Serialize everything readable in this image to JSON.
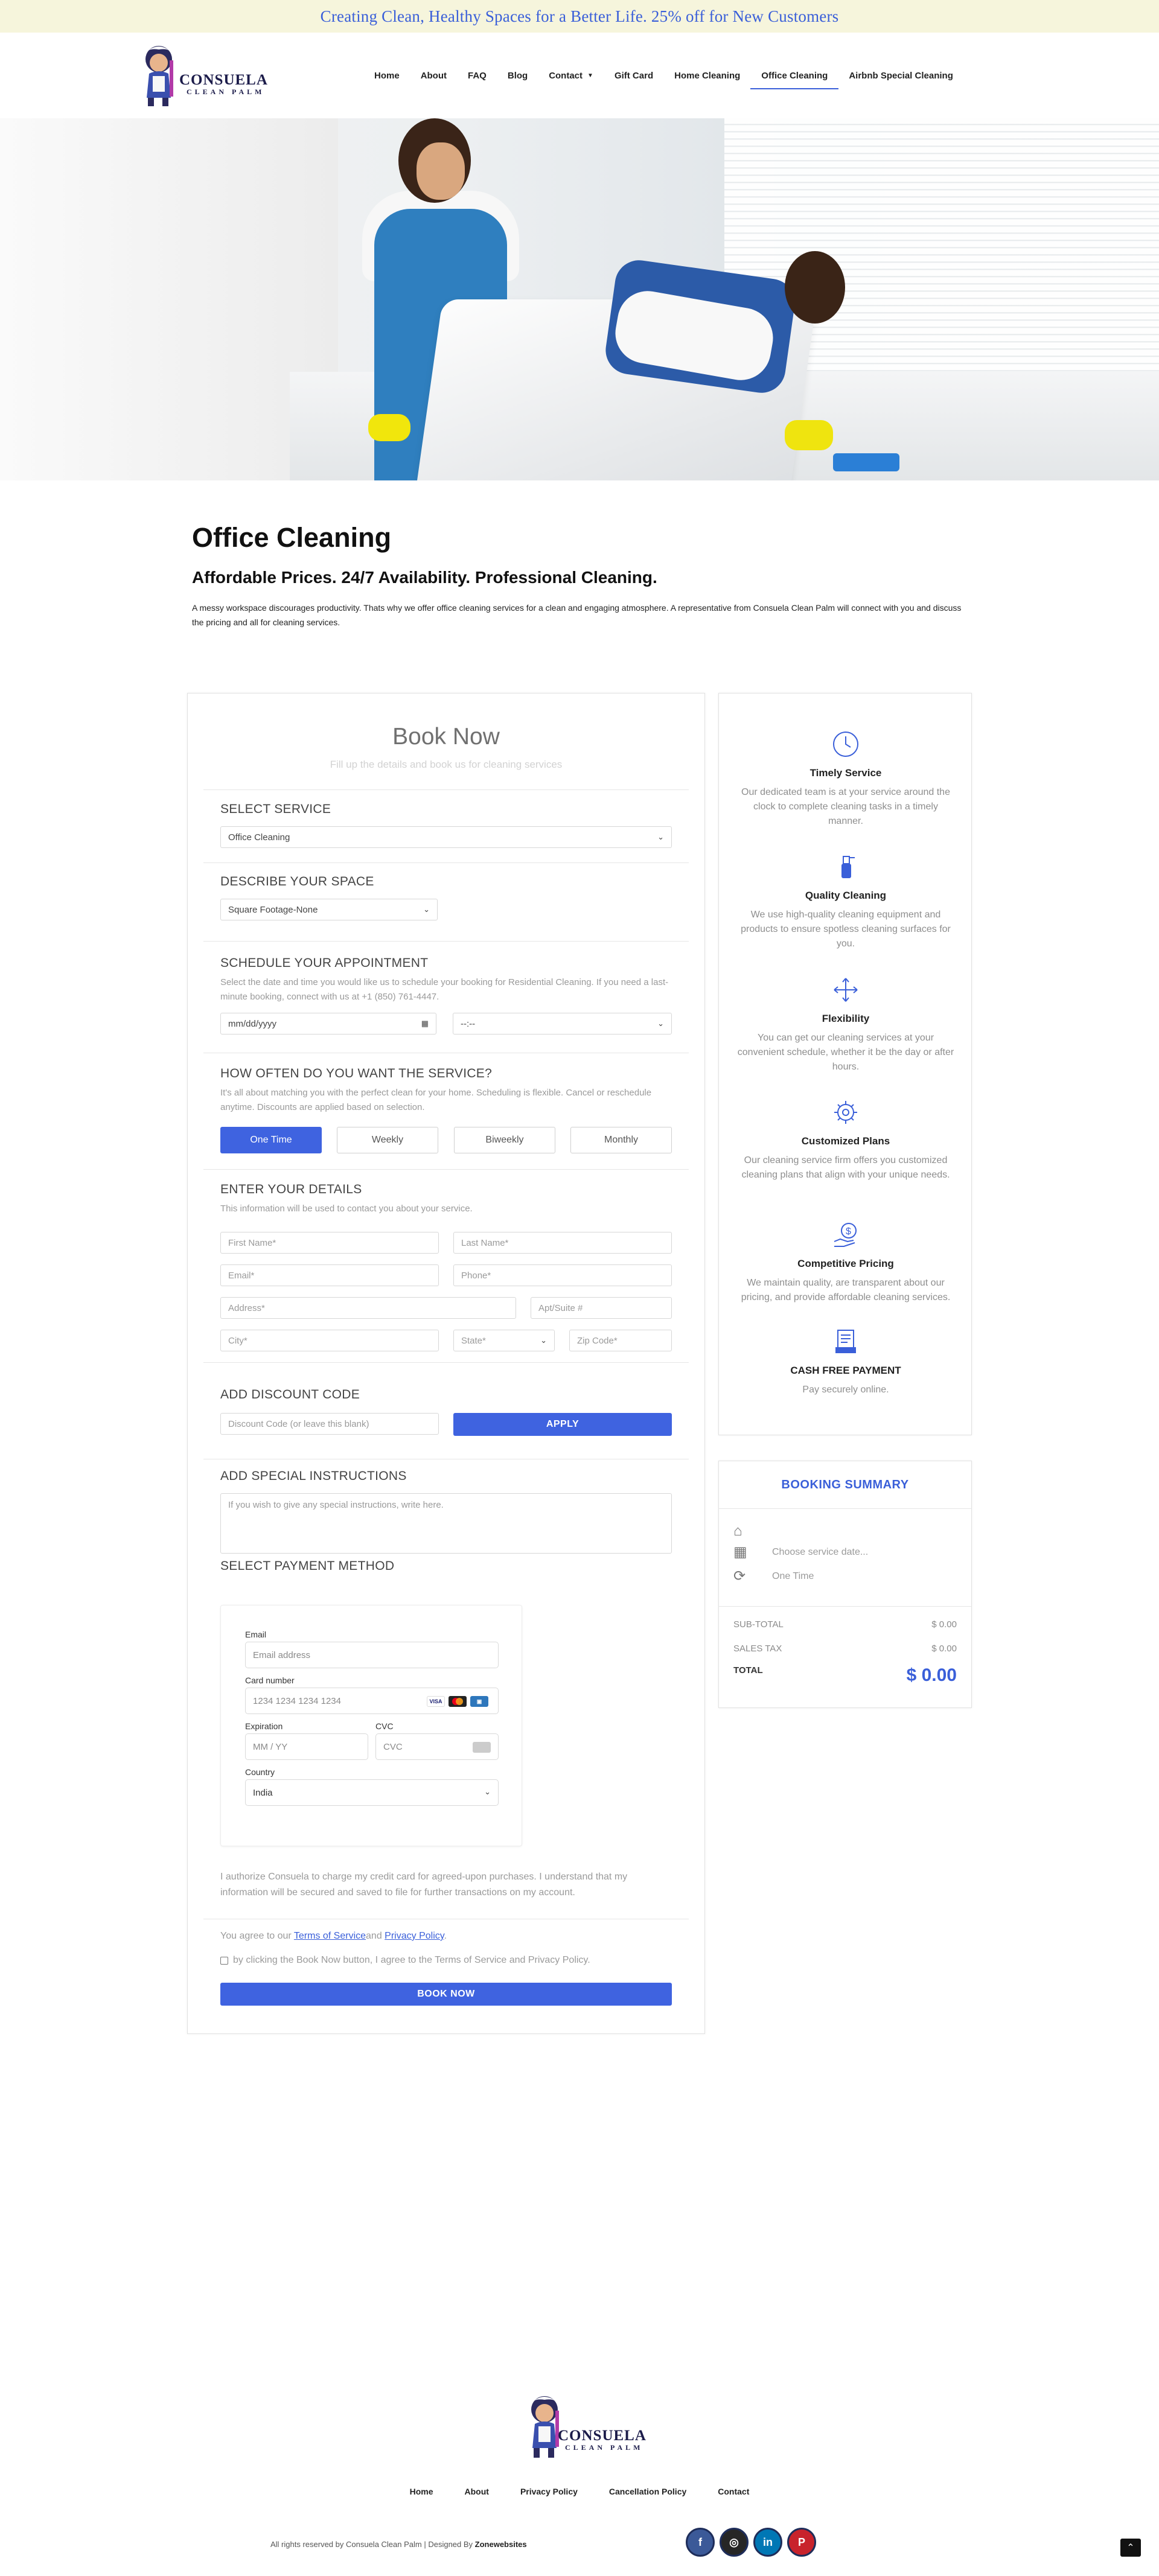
{
  "banner": {
    "text": "Creating Clean, Healthy Spaces for a Better Life. 25% off for New Customers"
  },
  "logo": {
    "line1": "CONSUELA",
    "line2": "CLEAN PALM"
  },
  "nav": {
    "items": [
      "Home",
      "About",
      "FAQ",
      "Blog",
      "Contact",
      "Gift Card",
      "Home Cleaning",
      "Office Cleaning",
      "Airbnb Special Cleaning"
    ],
    "active": "Office Cleaning"
  },
  "intro": {
    "title": "Office Cleaning",
    "subtitle": "Affordable Prices. 24/7 Availability. Professional Cleaning.",
    "text": "A messy workspace discourages productivity. Thats why we offer office cleaning services for a clean and engaging atmosphere. A representative from Consuela Clean Palm will connect with you and discuss the pricing and all for cleaning services."
  },
  "booking": {
    "title": "Book Now",
    "subtitle": "Fill up the details and book us for cleaning services",
    "select_service": {
      "heading": "SELECT SERVICE",
      "value": "Office Cleaning"
    },
    "describe_space": {
      "heading": "DESCRIBE YOUR SPACE",
      "value": "Square Footage-None"
    },
    "schedule": {
      "heading": "SCHEDULE YOUR APPOINTMENT",
      "desc": "Select the date and time you would like us to schedule your booking for Residential Cleaning. If you need a last-minute booking, connect with us at +1 (850) 761-4447.",
      "date_placeholder": "mm/dd/yyyy",
      "time_placeholder": "--:--"
    },
    "frequency": {
      "heading": "HOW OFTEN DO YOU WANT THE SERVICE?",
      "desc": "It's all about matching you with the perfect clean for your home. Scheduling is flexible. Cancel or reschedule anytime. Discounts are applied based on selection.",
      "options": [
        "One Time",
        "Weekly",
        "Biweekly",
        "Monthly"
      ],
      "selected": "One Time"
    },
    "details": {
      "heading": "ENTER YOUR DETAILS",
      "desc": "This information will be used to contact you about your service.",
      "first_name": "First Name*",
      "last_name": "Last Name*",
      "email": "Email*",
      "phone": "Phone*",
      "address": "Address*",
      "apt": "Apt/Suite #",
      "city": "City*",
      "state": "State*",
      "zip": "Zip Code*"
    },
    "discount": {
      "heading": "ADD DISCOUNT CODE",
      "placeholder": "Discount Code (or leave this blank)",
      "apply": "APPLY"
    },
    "instructions": {
      "heading": "ADD SPECIAL INSTRUCTIONS",
      "placeholder": "If you wish to give any special instructions, write here."
    },
    "payment": {
      "heading": "SELECT PAYMENT METHOD",
      "email_label": "Email",
      "email_placeholder": "Email address",
      "card_label": "Card number",
      "card_placeholder": "1234 1234 1234 1234",
      "expiration_label": "Expiration",
      "expiration_placeholder": "MM / YY",
      "cvc_label": "CVC",
      "cvc_placeholder": "CVC",
      "country_label": "Country",
      "country_value": "India",
      "brands": [
        "VISA",
        "MC",
        "AMEX"
      ]
    },
    "authorize": "I authorize Consuela to charge my credit card for agreed-upon purchases. I understand that my information will be secured and saved to file for further transactions on my account.",
    "agree_prefix": "You agree to our ",
    "terms_link": "Terms of Service",
    "and": "and ",
    "privacy_link": "Privacy Policy",
    "agree_suffix": ".",
    "checkbox_label": "by clicking the Book Now button, I agree to the Terms of Service and Privacy Policy.",
    "submit": "BOOK NOW"
  },
  "features": [
    {
      "icon": "clock-icon",
      "title": "Timely Service",
      "desc": "Our dedicated team is at your service around the clock to complete cleaning tasks in a timely manner."
    },
    {
      "icon": "spray-bottle-icon",
      "title": "Quality Cleaning",
      "desc": "We use high-quality cleaning equipment and products to ensure spotless cleaning surfaces for you."
    },
    {
      "icon": "arrows-icon",
      "title": "Flexibility",
      "desc": "You can get our cleaning services at your convenient schedule, whether it be the day or after hours."
    },
    {
      "icon": "gear-icon",
      "title": "Customized Plans",
      "desc": "Our cleaning service firm offers you customized cleaning plans that align with your unique needs."
    },
    {
      "icon": "dollar-hand-icon",
      "title": "Competitive Pricing",
      "desc": "We maintain quality, are transparent about our pricing, and provide affordable cleaning services."
    },
    {
      "icon": "receipt-icon",
      "title": "CASH FREE PAYMENT",
      "desc": "Pay securely online."
    }
  ],
  "summary": {
    "title": "BOOKING SUMMARY",
    "date": "Choose service date...",
    "frequency": "One Time",
    "subtotal_label": "SUB-TOTAL",
    "subtotal": "$ 0.00",
    "tax_label": "SALES TAX",
    "tax": "$ 0.00",
    "total_label": "TOTAL",
    "total": "$ 0.00"
  },
  "footer": {
    "links": [
      "Home",
      "About",
      "Privacy Policy",
      "Cancellation Policy",
      "Contact"
    ],
    "copyright": "All rights reserved by Consuela Clean Palm | Designed By ",
    "designer": "Zonewebsites",
    "socials": [
      "facebook-icon",
      "instagram-icon",
      "linkedin-icon",
      "pinterest-icon"
    ]
  },
  "colors": {
    "accent": "#3f63e0",
    "banner_bg": "#f6f5dc",
    "banner_text": "#3a5fd9"
  }
}
